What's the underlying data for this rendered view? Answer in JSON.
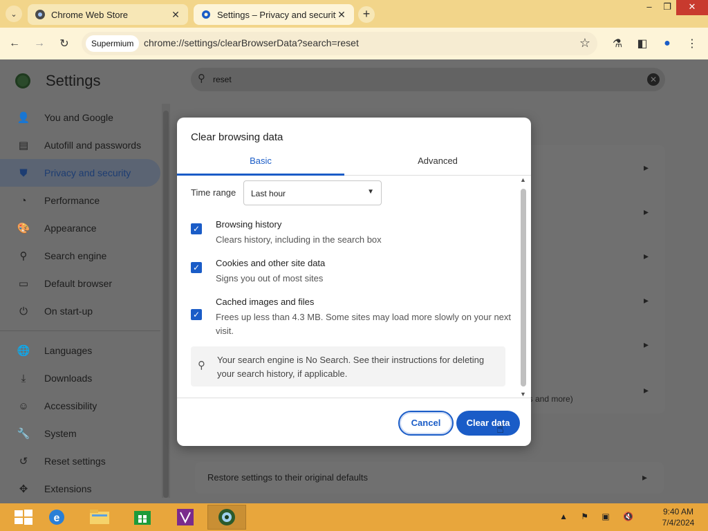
{
  "browser": {
    "tabs": [
      {
        "title": "Chrome Web Store",
        "active": false
      },
      {
        "title": "Settings – Privacy and security",
        "active": true
      }
    ],
    "profile_chip": "Supermium",
    "url": "chrome://settings/clearBrowserData?search=reset"
  },
  "settings": {
    "title": "Settings",
    "search_value": "reset",
    "nav": [
      {
        "label": "You and Google",
        "icon": "person-icon"
      },
      {
        "label": "Autofill and passwords",
        "icon": "clipboard-icon"
      },
      {
        "label": "Privacy and security",
        "icon": "shield-icon",
        "selected": true
      },
      {
        "label": "Performance",
        "icon": "gauge-icon"
      },
      {
        "label": "Appearance",
        "icon": "palette-icon"
      },
      {
        "label": "Search engine",
        "icon": "search-icon"
      },
      {
        "label": "Default browser",
        "icon": "browser-icon"
      },
      {
        "label": "On start-up",
        "icon": "power-icon"
      },
      {
        "label": "Languages",
        "icon": "globe-icon"
      },
      {
        "label": "Downloads",
        "icon": "download-icon"
      },
      {
        "label": "Accessibility",
        "icon": "accessibility-icon"
      },
      {
        "label": "System",
        "icon": "wrench-icon"
      },
      {
        "label": "Reset settings",
        "icon": "reset-icon"
      },
      {
        "label": "Extensions",
        "icon": "puzzle-icon"
      }
    ],
    "partial_text": "es and more)",
    "reset_row": "Restore settings to their original defaults"
  },
  "dialog": {
    "title": "Clear browsing data",
    "tabs": [
      "Basic",
      "Advanced"
    ],
    "time_range_label": "Time range",
    "time_range_value": "Last hour",
    "options": [
      {
        "title": "Browsing history",
        "desc": "Clears history, including in the search box",
        "checked": true
      },
      {
        "title": "Cookies and other site data",
        "desc": "Signs you out of most sites",
        "checked": true
      },
      {
        "title": "Cached images and files",
        "desc": "Frees up less than 4.3 MB. Some sites may load more slowly on your next visit.",
        "checked": true
      }
    ],
    "info": "Your search engine is No Search. See their instructions for deleting your search history, if applicable.",
    "cancel_label": "Cancel",
    "clear_label": "Clear data"
  },
  "taskbar": {
    "time": "9:40 AM",
    "date": "7/4/2024"
  },
  "colors": {
    "accent": "#1a5cc7",
    "taskbar": "#e8a63c",
    "tabstrip": "#f2d58a"
  }
}
